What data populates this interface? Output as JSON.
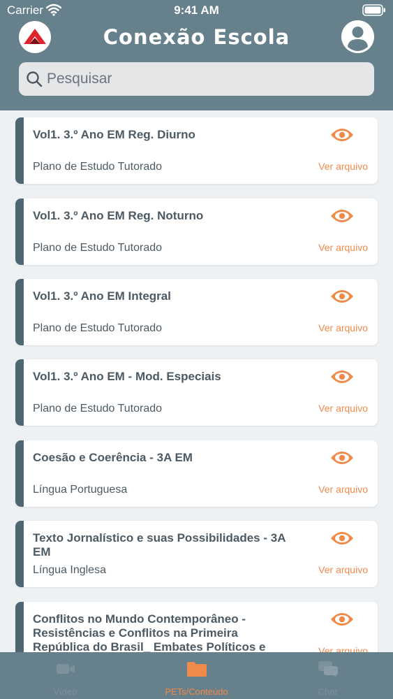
{
  "status": {
    "carrier": "Carrier",
    "time": "9:41 AM"
  },
  "header": {
    "title": "Conexão Escola"
  },
  "search": {
    "placeholder": "Pesquisar"
  },
  "items": [
    {
      "title": "Vol1. 3.º Ano EM Reg. Diurno",
      "subtitle": "Plano de Estudo Tutorado",
      "link": "Ver arquivo"
    },
    {
      "title": "Vol1. 3.º Ano EM Reg. Noturno",
      "subtitle": "Plano de Estudo Tutorado",
      "link": "Ver arquivo"
    },
    {
      "title": "Vol1. 3.º Ano EM Integral",
      "subtitle": "Plano de Estudo Tutorado",
      "link": "Ver arquivo"
    },
    {
      "title": "Vol1. 3.º Ano EM - Mod. Especiais",
      "subtitle": "Plano de Estudo Tutorado",
      "link": "Ver arquivo"
    },
    {
      "title": "Coesão e Coerência - 3A EM",
      "subtitle": "Língua Portuguesa",
      "link": "Ver arquivo"
    },
    {
      "title": "Texto Jornalístico e suas Possibilidades - 3A EM",
      "subtitle": "Língua Inglesa",
      "link": "Ver arquivo"
    },
    {
      "title": "Conflitos no Mundo Contemporâneo - Resistências e Conflitos na Primeira República do Brasil_ Embates Políticos e",
      "subtitle": "",
      "link": "Ver arquivo"
    }
  ],
  "tabs": [
    {
      "label": "Vídeo",
      "icon": "video-camera-icon",
      "active": false
    },
    {
      "label": "PETs/Conteúdo",
      "icon": "folder-icon",
      "active": true
    },
    {
      "label": "Chat",
      "icon": "chat-bubbles-icon",
      "active": false
    }
  ],
  "colors": {
    "header": "#66808c",
    "accent": "#f08a4b",
    "card_stripe": "#4f6773",
    "tab_inactive": "#7d919b"
  }
}
